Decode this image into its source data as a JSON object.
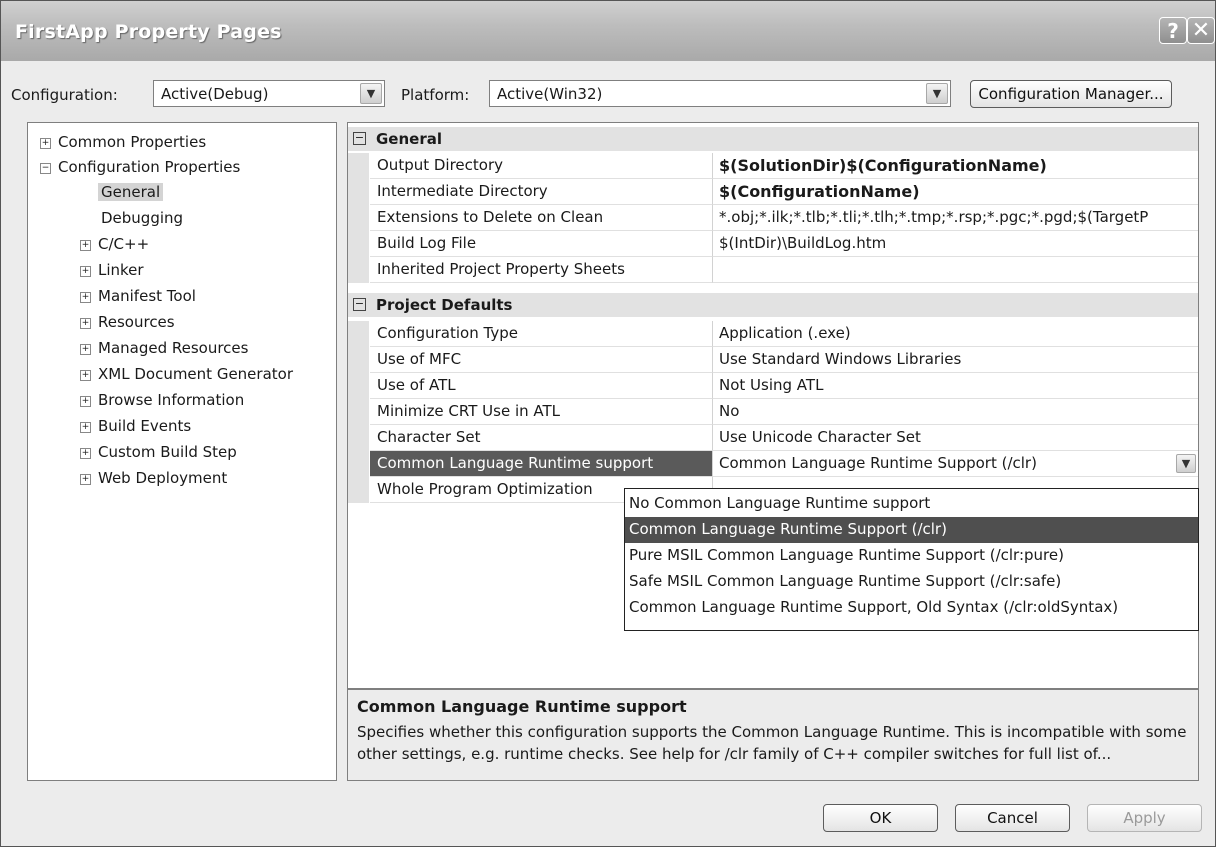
{
  "window": {
    "title": "FirstApp Property Pages",
    "help_glyph": "?",
    "close_glyph": "✕"
  },
  "toolbar": {
    "configuration_label": "Configuration:",
    "configuration_value": "Active(Debug)",
    "platform_label": "Platform:",
    "platform_value": "Active(Win32)",
    "config_manager_label": "Configuration Manager..."
  },
  "tree": {
    "items": [
      {
        "label": "Common Properties",
        "expander": "+"
      },
      {
        "label": "Configuration Properties",
        "expander": "−"
      },
      {
        "label": "General",
        "selected": true
      },
      {
        "label": "Debugging"
      },
      {
        "label": "C/C++",
        "expander": "+"
      },
      {
        "label": "Linker",
        "expander": "+"
      },
      {
        "label": "Manifest Tool",
        "expander": "+"
      },
      {
        "label": "Resources",
        "expander": "+"
      },
      {
        "label": "Managed Resources",
        "expander": "+"
      },
      {
        "label": "XML Document Generator",
        "expander": "+"
      },
      {
        "label": "Browse Information",
        "expander": "+"
      },
      {
        "label": "Build Events",
        "expander": "+"
      },
      {
        "label": "Custom Build Step",
        "expander": "+"
      },
      {
        "label": "Web Deployment",
        "expander": "+"
      }
    ]
  },
  "grid": {
    "general": {
      "title": "General",
      "rows": [
        {
          "name": "Output Directory",
          "value": "$(SolutionDir)$(ConfigurationName)"
        },
        {
          "name": "Intermediate Directory",
          "value": "$(ConfigurationName)"
        },
        {
          "name": "Extensions to Delete on Clean",
          "value": "*.obj;*.ilk;*.tlb;*.tli;*.tlh;*.tmp;*.rsp;*.pgc;*.pgd;$(TargetP"
        },
        {
          "name": "Build Log File",
          "value": "$(IntDir)\\BuildLog.htm"
        },
        {
          "name": "Inherited Project Property Sheets",
          "value": ""
        }
      ]
    },
    "project_defaults": {
      "title": "Project Defaults",
      "rows": [
        {
          "name": "Configuration Type",
          "value": "Application (.exe)"
        },
        {
          "name": "Use of MFC",
          "value": "Use Standard Windows Libraries"
        },
        {
          "name": "Use of ATL",
          "value": "Not Using ATL"
        },
        {
          "name": "Minimize CRT Use in ATL",
          "value": "No"
        },
        {
          "name": "Character Set",
          "value": "Use Unicode Character Set"
        },
        {
          "name": "Common Language Runtime support",
          "value": "Common Language Runtime Support (/clr)"
        },
        {
          "name": "Whole Program Optimization",
          "value": ""
        }
      ]
    },
    "collapse_glyph": "−"
  },
  "dropdown": {
    "options": [
      "No Common Language Runtime support",
      "Common Language Runtime Support (/clr)",
      "Pure MSIL Common Language Runtime Support (/clr:pure)",
      "Safe MSIL Common Language Runtime Support (/clr:safe)",
      "Common Language Runtime Support, Old Syntax (/clr:oldSyntax)"
    ],
    "highlighted_index": 1
  },
  "description": {
    "title": "Common Language Runtime support",
    "text": "Specifies whether this configuration supports the Common Language Runtime.  This is incompatible with some other settings, e.g. runtime checks. See help for /clr family of C++ compiler switches for full list of..."
  },
  "buttons": {
    "ok": "OK",
    "cancel": "Cancel",
    "apply": "Apply"
  },
  "icons": {
    "dropdown_arrow": "chevron-down-icon",
    "dropdown_glyph": "▼"
  }
}
